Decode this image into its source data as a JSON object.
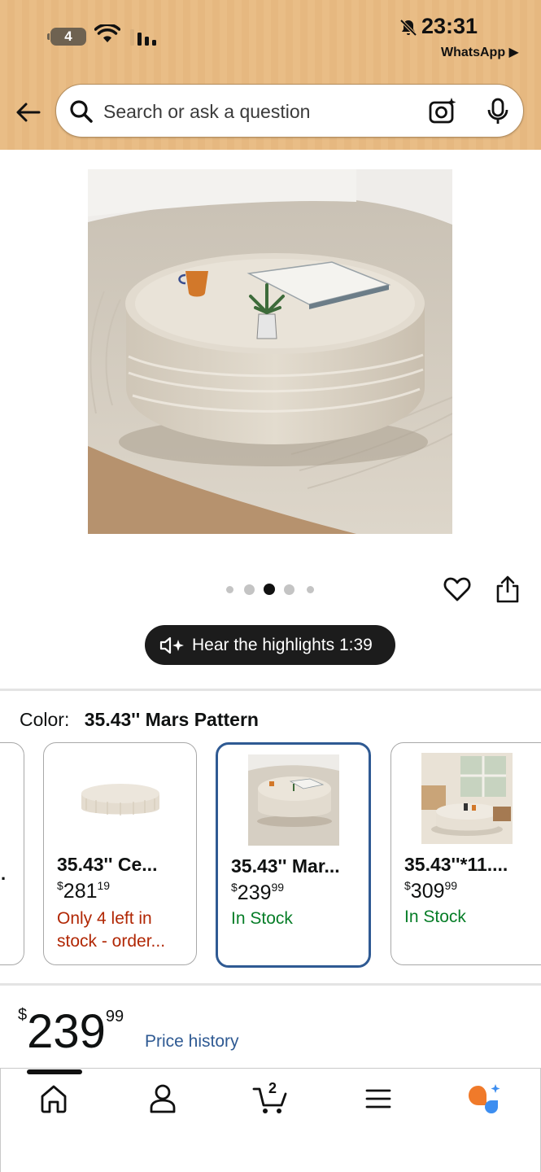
{
  "status_bar": {
    "battery": "4",
    "time": "23:31",
    "back_app": "WhatsApp ▶"
  },
  "search": {
    "placeholder": "Search or ask a question"
  },
  "gallery": {
    "dot_count": 5,
    "active_dot": 3
  },
  "highlights": {
    "label": "Hear the highlights 1:39"
  },
  "color": {
    "label": "Color:",
    "value": "35.43'' Mars Pattern"
  },
  "variants": [
    {
      "name": "35.43'' Ce...",
      "price_currency": "$",
      "price_whole": "281",
      "price_cents": "19",
      "stock": "Only 4 left in stock - order...",
      "stock_type": "low"
    },
    {
      "name": "35.43'' Mar...",
      "price_currency": "$",
      "price_whole": "239",
      "price_cents": "99",
      "stock": "In Stock",
      "stock_type": "in",
      "selected": true
    },
    {
      "name": "35.43''*11....",
      "price_currency": "$",
      "price_whole": "309",
      "price_cents": "99",
      "stock": "In Stock",
      "stock_type": "in"
    }
  ],
  "price": {
    "currency": "$",
    "whole": "239",
    "cents": "99",
    "history_link": "Price history"
  },
  "bottom_nav": {
    "cart_count": "2",
    "items": [
      "home-icon",
      "account-icon",
      "cart-icon",
      "menu-icon",
      "rufus-assistant-icon"
    ]
  },
  "colors": {
    "header_bg": "#e9bd86",
    "link_blue": "#2f5a93",
    "in_stock_green": "#067d27",
    "low_stock_red": "#b12704",
    "selected_border": "#2f5a93",
    "assistant_orange": "#f07a2a",
    "assistant_blue": "#3d8ef0"
  }
}
